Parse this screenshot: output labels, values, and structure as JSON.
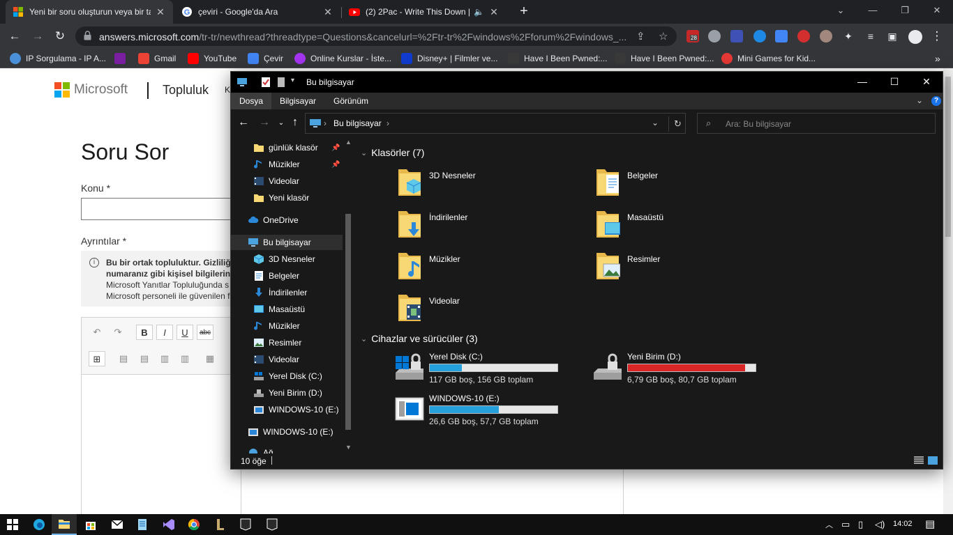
{
  "browser": {
    "tabs": [
      {
        "title": "Yeni bir soru oluşturun veya bir ta",
        "active": true
      },
      {
        "title": "çeviri - Google'da Ara",
        "active": false
      },
      {
        "title": "(2) 2Pac - Write This Down | ",
        "active": false
      }
    ],
    "url_host": "answers.microsoft.com",
    "url_rest": "/tr-tr/newthread?threadtype=Questions&cancelurl=%2Ftr-tr%2Fwindows%2Fforum%2Fwindows_...",
    "extension_badge": "28",
    "bookmarks": [
      "IP Sorgulama - IP A...",
      "Gmail",
      "YouTube",
      "Çevir",
      "Online Kurslar - İste...",
      "Disney+ | Filmler ve...",
      "Have I Been Pwned:...",
      "Have I Been Pwned:...",
      "Mini Games for Kid..."
    ]
  },
  "webpage": {
    "brand": "Microsoft",
    "section": "Topluluk",
    "section_partial": "K",
    "heading": "Soru Sor",
    "subject_label": "Konu *",
    "details_label": "Ayrıntılar *",
    "notice_lines": [
      "Bu bir ortak topluluktur. Gizliliğin",
      "numaranız gibi kişisel bilgilerini:",
      "Microsoft Yanıtlar Topluluğunda s",
      "Microsoft personeli ile güvenilen f"
    ],
    "editor_buttons": [
      "B",
      "I",
      "U",
      "abc"
    ]
  },
  "explorer": {
    "title": "Bu bilgisayar",
    "ribbon_tabs": [
      "Dosya",
      "Bilgisayar",
      "Görünüm"
    ],
    "address": "Bu bilgisayar",
    "search_placeholder": "Ara: Bu bilgisayar",
    "tree": [
      {
        "label": "günlük klasör",
        "icon": "folder-icon",
        "pinned": true
      },
      {
        "label": "Müzikler",
        "icon": "music-icon",
        "pinned": true
      },
      {
        "label": "Videolar",
        "icon": "video-icon",
        "pinned": false
      },
      {
        "label": "Yeni klasör",
        "icon": "folder-icon",
        "pinned": false
      },
      {
        "label": "OneDrive",
        "icon": "cloud-icon",
        "pinned": false
      },
      {
        "label": "Bu bilgisayar",
        "icon": "pc-icon",
        "pinned": false,
        "selected": true
      },
      {
        "label": "3D Nesneler",
        "icon": "cube-icon",
        "pinned": false
      },
      {
        "label": "Belgeler",
        "icon": "document-icon",
        "pinned": false
      },
      {
        "label": "İndirilenler",
        "icon": "download-icon",
        "pinned": false
      },
      {
        "label": "Masaüstü",
        "icon": "desktop-icon",
        "pinned": false
      },
      {
        "label": "Müzikler",
        "icon": "music-icon",
        "pinned": false
      },
      {
        "label": "Resimler",
        "icon": "pictures-icon",
        "pinned": false
      },
      {
        "label": "Videolar",
        "icon": "video-icon",
        "pinned": false
      },
      {
        "label": "Yerel Disk (C:)",
        "icon": "drive-icon",
        "pinned": false
      },
      {
        "label": "Yeni Birim (D:)",
        "icon": "drive-icon",
        "pinned": false
      },
      {
        "label": "WINDOWS-10 (E:)",
        "icon": "usb-drive-icon",
        "pinned": false
      },
      {
        "label": "WINDOWS-10 (E:)",
        "icon": "usb-drive-icon",
        "pinned": false
      },
      {
        "label": "Ağ",
        "icon": "network-icon",
        "pinned": false
      }
    ],
    "folders_header": "Klasörler (7)",
    "folders": [
      "3D Nesneler",
      "Belgeler",
      "İndirilenler",
      "Masaüstü",
      "Müzikler",
      "Resimler",
      "Videolar"
    ],
    "devices_header": "Cihazlar ve sürücüler (3)",
    "drives": [
      {
        "name": "Yerel Disk (C:)",
        "info": "117 GB boş, 156 GB toplam",
        "used_fraction": 0.25,
        "color": "#26a0da"
      },
      {
        "name": "Yeni Birim (D:)",
        "info": "6,79 GB boş, 80,7 GB toplam",
        "used_fraction": 0.92,
        "color": "#da2626"
      },
      {
        "name": "WINDOWS-10 (E:)",
        "info": "26,6 GB boş, 57,7 GB toplam",
        "used_fraction": 0.54,
        "color": "#26a0da"
      }
    ],
    "status": "10 öğe"
  },
  "taskbar": {
    "clock": "14:02"
  },
  "colors": {
    "accent": "#26a0da",
    "warning": "#da2626",
    "folder": "#f8d775"
  }
}
